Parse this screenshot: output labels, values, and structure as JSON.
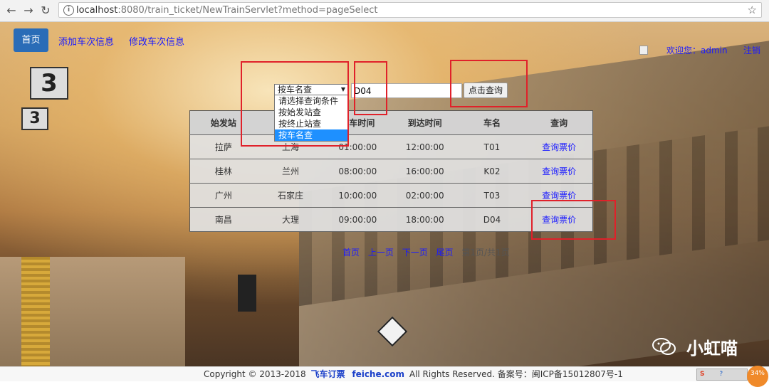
{
  "browser": {
    "url_host": "localhost",
    "url_rest": ":8080/train_ticket/NewTrainServlet?method=pageSelect"
  },
  "nav": {
    "home": "首页",
    "add_train": "添加车次信息",
    "edit_train": "修改车次信息",
    "welcome": "欢迎您：admin",
    "logout": "注销"
  },
  "search": {
    "selected": "按车名查",
    "options": [
      "请选择查询条件",
      "按始发站查",
      "按终止站查",
      "按车名查"
    ],
    "input_value": "D04",
    "button": "点击查询"
  },
  "table": {
    "headers": [
      "始发站",
      "终止站",
      "发车时间",
      "到达时间",
      "车名",
      "查询"
    ],
    "rows": [
      [
        "拉萨",
        "上海",
        "01:00:00",
        "12:00:00",
        "T01",
        "查询票价"
      ],
      [
        "桂林",
        "兰州",
        "08:00:00",
        "16:00:00",
        "K02",
        "查询票价"
      ],
      [
        "广州",
        "石家庄",
        "10:00:00",
        "02:00:00",
        "T03",
        "查询票价"
      ],
      [
        "南昌",
        "大理",
        "09:00:00",
        "18:00:00",
        "D04",
        "查询票价"
      ]
    ]
  },
  "pager": {
    "first": "首页",
    "prev": "上一页",
    "next": "下一页",
    "last": "尾页",
    "info": "第1页/共1页"
  },
  "watermark": "小虹喵",
  "footer": {
    "copyright": "Copyright © 2013-2018",
    "brand1": "飞车订票",
    "brand2": "feiche.com",
    "rights": "All Rights Reserved. 备案号：闽ICP备15012807号-1"
  },
  "tray": {
    "badge": "34%"
  },
  "colors": {
    "accent": "#2a6cb7",
    "link": "#1a1aff",
    "annotation": "#e0212a"
  }
}
